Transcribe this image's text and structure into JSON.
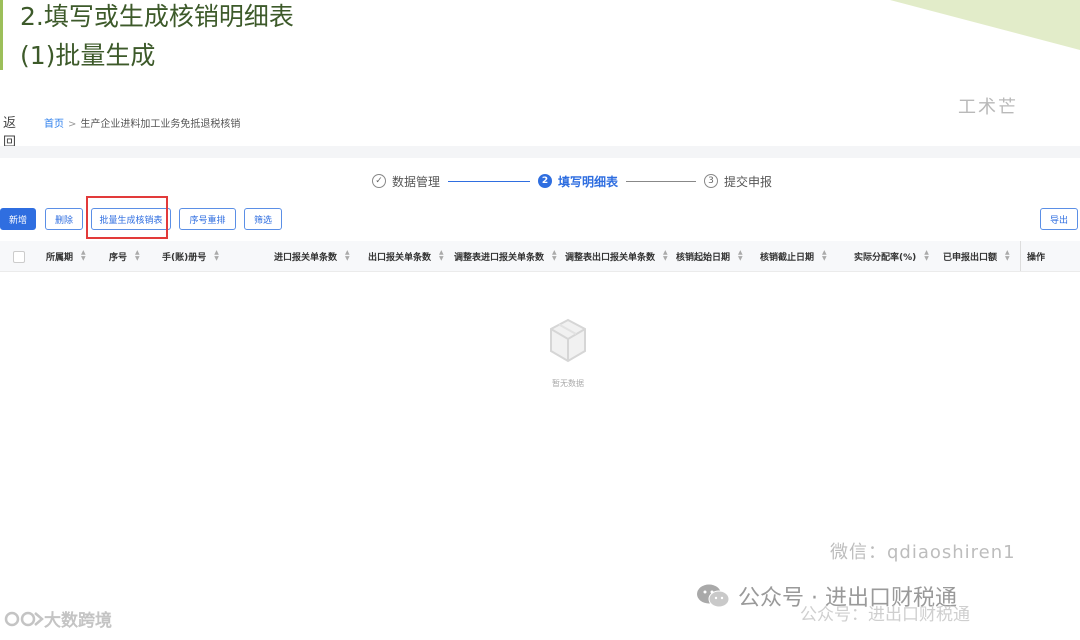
{
  "slide": {
    "title": "2.填写或生成核销明细表",
    "subtitle": "(1)批量生成"
  },
  "stamp_text": "工术芒",
  "nav": {
    "back_label": "返回",
    "breadcrumb_home": "首页",
    "breadcrumb_separator": ">",
    "breadcrumb_page": "生产企业进料加工业务免抵退税核销"
  },
  "steps": [
    {
      "number": "✓",
      "label": "数据管理",
      "state": "done"
    },
    {
      "number": "2",
      "label": "填写明细表",
      "state": "active"
    },
    {
      "number": "3",
      "label": "提交申报",
      "state": "pending"
    }
  ],
  "toolbar": {
    "add": "新增",
    "delete": "删除",
    "batch_generate": "批量生成核销表",
    "reorder": "序号重排",
    "filter": "筛选",
    "export": "导出"
  },
  "table": {
    "columns": [
      "所属期",
      "序号",
      "手(账)册号",
      "进口报关单条数",
      "出口报关单条数",
      "调整表进口报关单条数",
      "调整表出口报关单条数",
      "核销起始日期",
      "核销截止日期",
      "实际分配率(%)",
      "已申报出口额",
      "操作"
    ],
    "rows": [],
    "empty_text": "暂无数据"
  },
  "watermarks": {
    "wechat_id": "微信：qdiaoshiren1",
    "official_account": "公众号 · 进出口财税通",
    "official_account_echo": "公众号：进出口财税通",
    "brand": "大数跨境"
  },
  "colors": {
    "accent_blue": "#2f6ee0",
    "highlight_red": "#e23a3a",
    "title_green": "#3d5a2a"
  }
}
